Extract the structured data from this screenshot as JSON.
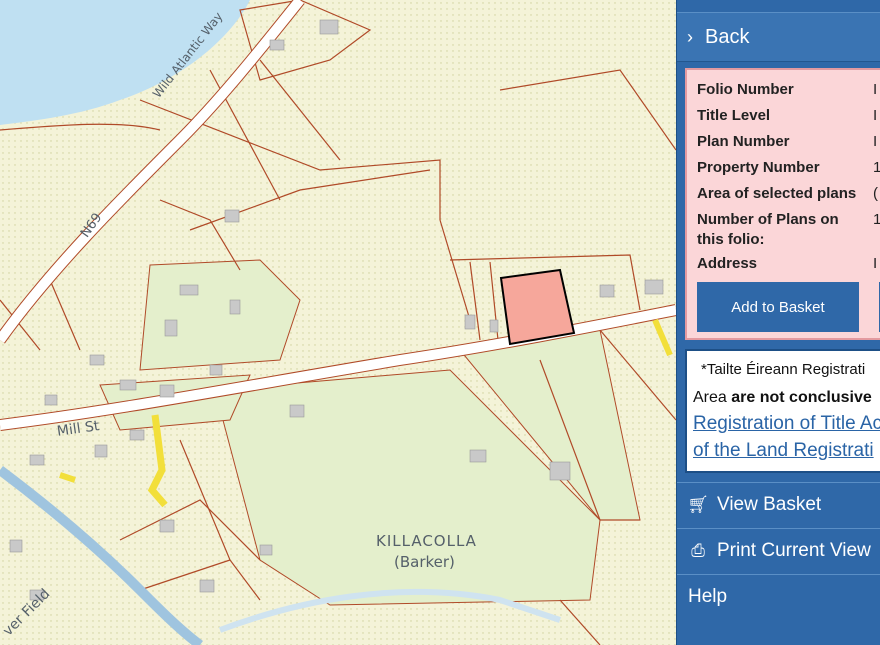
{
  "map": {
    "labels": {
      "wild_atlantic_way": "Wild Atlantic Way",
      "n69": "N69",
      "mill_st": "Mill St",
      "killacolla": "KILLACOLLA",
      "barker": "(Barker)",
      "river_field": "ver Field"
    },
    "colors": {
      "land": "#f4f3d8",
      "water": "#bfe0f2",
      "road": "#ffffff",
      "boundary": "#b04a28",
      "selected_parcel": "#f6a79b",
      "field": "#e4efcc"
    }
  },
  "panel": {
    "back_label": "Back",
    "info": {
      "rows": [
        {
          "label": "Folio Number",
          "value": "I"
        },
        {
          "label": "Title Level",
          "value": "I"
        },
        {
          "label": "Plan Number",
          "value": "I"
        },
        {
          "label": "Property Number",
          "value": "1"
        },
        {
          "label": "Area of selected plans",
          "value": "("
        },
        {
          "label": "Number of Plans on this folio:",
          "value": "1"
        },
        {
          "label": "Address",
          "value": "I"
        }
      ],
      "add_to_basket_label": "Add to Basket"
    },
    "notice": {
      "line1": "*Tailte Éireann Registrati",
      "line2_prefix": "Area ",
      "line2_bold": "are not conclusive",
      "link1": "Registration of Title Ac",
      "link2": "of the Land Registrati"
    },
    "menu": {
      "view_basket": "View Basket",
      "print_view": "Print Current View",
      "help": "Help"
    },
    "colors": {
      "panel": "#2f68a8",
      "info_bg": "#fbd6d8",
      "info_border": "#e39aa0"
    }
  }
}
